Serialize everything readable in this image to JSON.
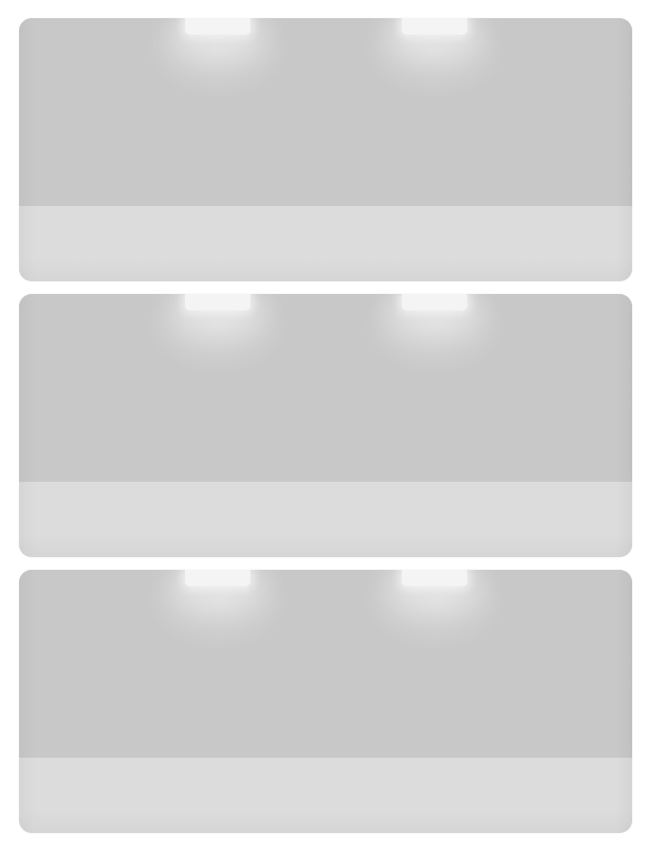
{
  "panels": [
    {
      "id": 1,
      "colors": {
        "top": "#c8c8c8",
        "bottom": "#dcdcdc",
        "light": "#f4f4f4"
      }
    },
    {
      "id": 2,
      "colors": {
        "top": "#c8c8c8",
        "bottom": "#dcdcdc",
        "light": "#f4f4f4"
      }
    },
    {
      "id": 3,
      "colors": {
        "top": "#c8c8c8",
        "bottom": "#dcdcdc",
        "light": "#f4f4f4"
      }
    }
  ]
}
